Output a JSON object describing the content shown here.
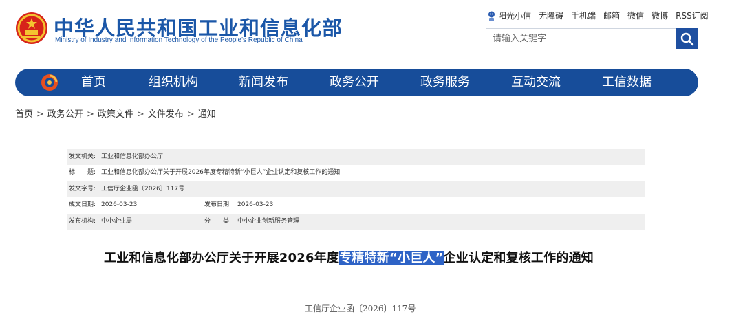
{
  "header": {
    "site_title": "中华人民共和国工业和信息化部",
    "site_subtitle": "Ministry of Industry and Information Technology of the People's Republic of China",
    "top_links": [
      "阳光小信",
      "无障碍",
      "手机端",
      "邮箱",
      "微信",
      "微博",
      "RSS订阅"
    ],
    "search": {
      "placeholder": "请输入关键字",
      "value": ""
    }
  },
  "nav": {
    "items": [
      "首页",
      "组织机构",
      "新闻发布",
      "政务公开",
      "政务服务",
      "互动交流",
      "工信数据"
    ]
  },
  "breadcrumb": [
    "首页",
    "政务公开",
    "政策文件",
    "文件发布",
    "通知"
  ],
  "info": {
    "issuer_label": "发文机关:",
    "issuer": "工业和信息化部办公厅",
    "title_label": "标　　题:",
    "title": "工业和信息化部办公厅关于开展2026年度专精特新“小巨人”企业认定和复核工作的通知",
    "doc_no_label": "发文字号:",
    "doc_no": "工信厅企业函〔2026〕117号",
    "created_label": "成文日期:",
    "created": "2026-03-23",
    "published_label": "发布日期:",
    "published": "2026-03-23",
    "org_label": "发布机构:",
    "org": "中小企业局",
    "category_label": "分　　类:",
    "category": "中小企业创新服务管理"
  },
  "document": {
    "title_before": "工业和信息化部办公厅关于开展2026年度",
    "title_selected": "专精特新“小巨人”",
    "title_after": "企业认定和复核工作的通知",
    "number": "工信厅企业函〔2026〕117号"
  },
  "colors": {
    "brand_blue": "#1b57a8",
    "nav_blue": "#174d9a",
    "selection": "#2e63c6",
    "row_shade": "#efefef"
  }
}
